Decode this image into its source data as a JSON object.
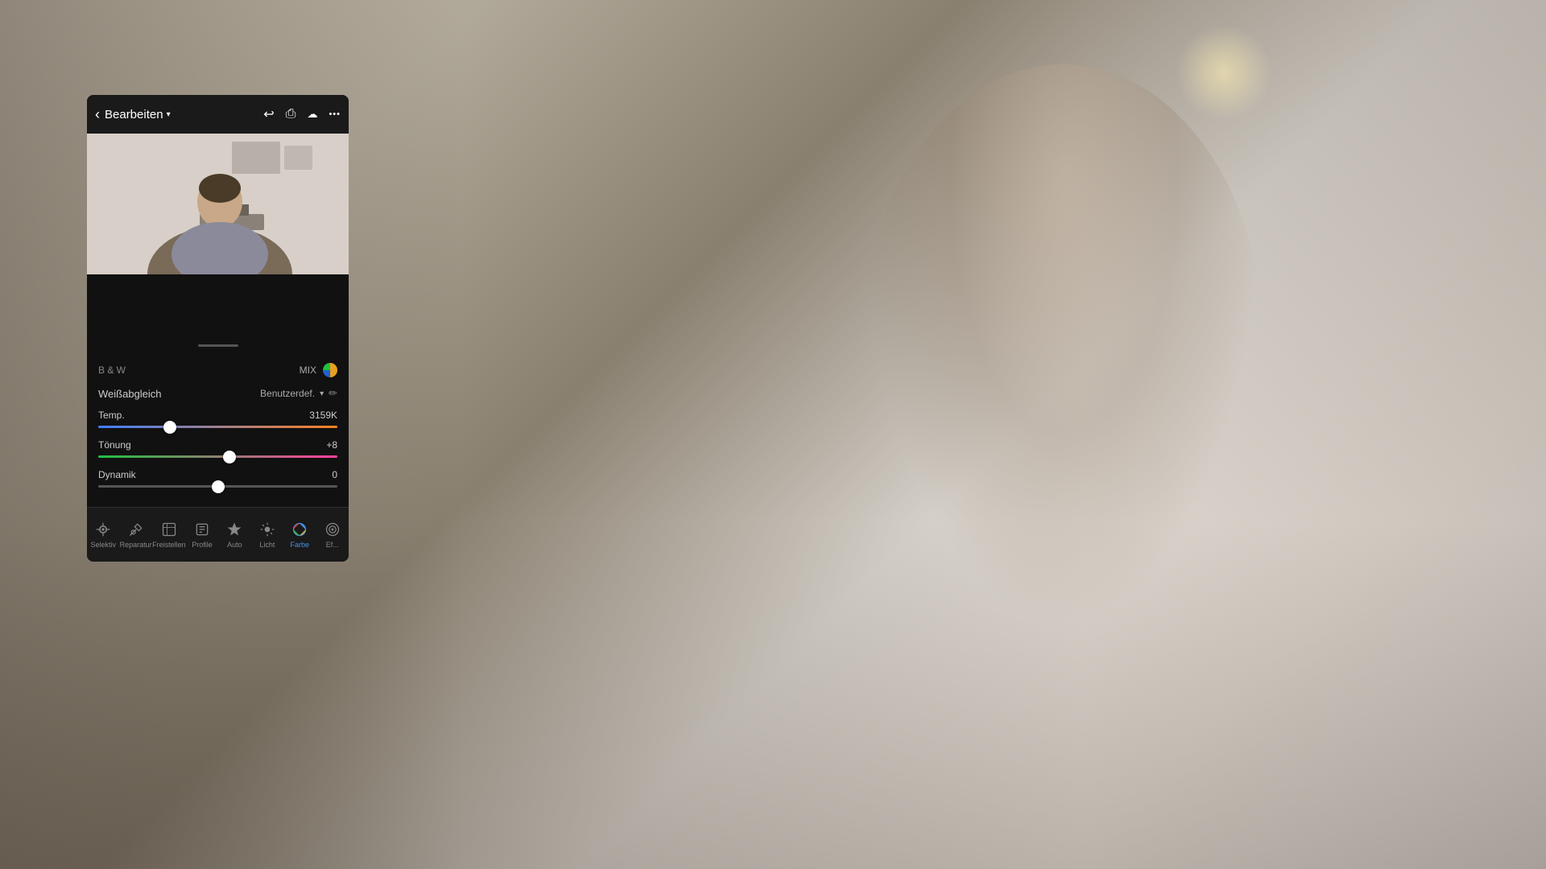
{
  "header": {
    "back_label": "‹",
    "title": "Bearbeiten",
    "title_arrow": "▾",
    "icon_undo": "↩",
    "icon_share": "⎙",
    "icon_cloud": "☁",
    "icon_more": "•••"
  },
  "controls": {
    "bw_label": "B & W",
    "mix_label": "MIX",
    "wb_section_label": "Weißabgleich",
    "wb_value": "Benutzerdef.",
    "wb_dropdown": "▾",
    "temp_label": "Temp.",
    "temp_value": "3159K",
    "temp_percent": 30,
    "toning_label": "Tönung",
    "toning_value": "+8",
    "toning_percent": 55,
    "dynamik_label": "Dynamik",
    "dynamik_value": "0",
    "dynamik_percent": 50
  },
  "toolbar": {
    "items": [
      {
        "id": "selektiv",
        "label": "Selektiv",
        "icon": "✦",
        "active": false
      },
      {
        "id": "reparatur",
        "label": "Reparatur",
        "icon": "✎",
        "active": false
      },
      {
        "id": "freistellen",
        "label": "Freistellen",
        "icon": "⬛",
        "active": false
      },
      {
        "id": "profile",
        "label": "Profile",
        "icon": "◈",
        "active": false
      },
      {
        "id": "auto",
        "label": "Auto",
        "icon": "✦",
        "active": false
      },
      {
        "id": "licht",
        "label": "Licht",
        "icon": "☀",
        "active": false
      },
      {
        "id": "farbe",
        "label": "Farbe",
        "icon": "♨",
        "active": true
      },
      {
        "id": "effekte",
        "label": "Ef...",
        "icon": "◉",
        "active": false
      }
    ]
  }
}
